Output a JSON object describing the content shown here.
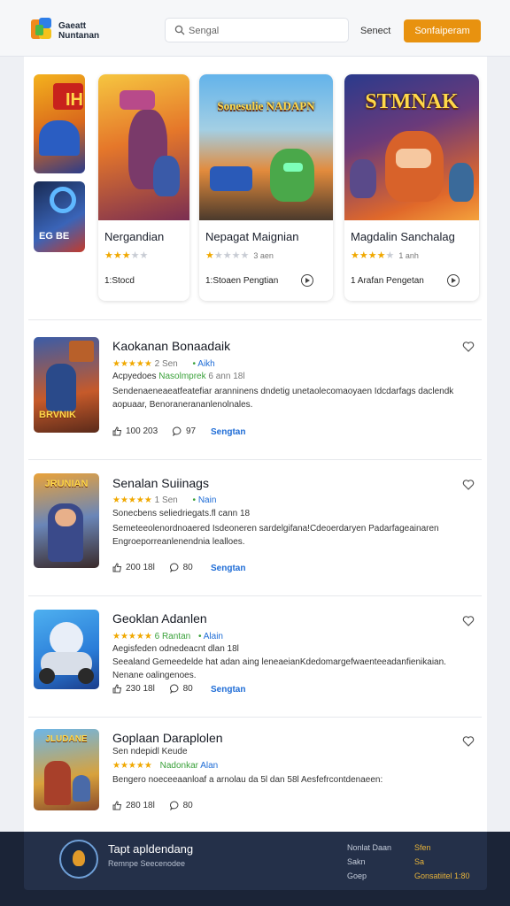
{
  "header": {
    "brand_line1": "Gaeatt",
    "brand_line2": "Nuntanan",
    "search_placeholder": "Sengal",
    "nav_link": "Senect",
    "cta_button": "Sonfaiperam"
  },
  "side_thumbs": [
    {
      "label": "IH"
    },
    {
      "label": "EG BE"
    }
  ],
  "featured": [
    {
      "name": "Nergandian",
      "art_title": "",
      "rating": 3.5,
      "meta": "1:Stocd"
    },
    {
      "name": "Nepagat Maignian",
      "art_title": "Sonesulie NADAPN",
      "rating": 1,
      "count": "3 aen",
      "meta": "1:Stoaen Pengtian"
    },
    {
      "name": "Magdalin Sanchalag",
      "art_title": "STMNAK",
      "rating": 4,
      "count": "1 anh",
      "meta": "1 Arafan Pengetan"
    }
  ],
  "list": [
    {
      "title": "Kaokanan Bonaadaik",
      "rating": "★★★★★",
      "count": "2 Sen",
      "tag": "Aikh",
      "sub": "Acpyedoes",
      "sub_green": "Nasolmprek",
      "sub_tail": "6 ann 18l",
      "desc": "Sendenaeneaeatfeatefiar aranninens dndetig unetaolecomaoyaen Idcdarfags daclendk aopuaar, Benoranerananlenolnales.",
      "likes": "100 203",
      "comments": "97",
      "link": "Sengtan",
      "thumb_text": "BRVNIK"
    },
    {
      "title": "Senalan Suiinags",
      "rating": "★★★★★",
      "count": "1 Sen",
      "tag": "Nain",
      "sub": "Sonecbens seliedriegats.fl cann 18",
      "sub_green": "",
      "sub_tail": "",
      "desc": "Semeteeolenordnoaered Isdeoneren sardelgifana!Cdeoerdaryen Padarfageainaren Engroeporreanlenendnia lealloes.",
      "likes": "200 18l",
      "comments": "80",
      "link": "Sengtan",
      "thumb_text": "JRUNIAN"
    },
    {
      "title": "Geoklan Adanlen",
      "rating": "★★★★★",
      "count": "6 Rantan",
      "tag": "Alain",
      "sub": "Aegisfeden odnedeacnt dlan 18l",
      "sub_green": "",
      "sub_tail": "",
      "desc": "Seealand Gemeedelde hat adan aing leneaeianKdedomargefwaenteeadanfienikaian. Nenane oalingenoes.",
      "likes": "230 18l",
      "comments": "80",
      "link": "Sengtan",
      "thumb_text": ""
    },
    {
      "title": "Goplaan Daraplolen",
      "rating": "★★★★★",
      "count": "",
      "tag": "Alan",
      "sub": "Sen ndepidl Keude",
      "sub_green": "Nadonkar",
      "sub_tail": "",
      "desc": "Bengero noeceeaanloaf a arnolau da 5l dan 58l Aesfefrcontdenaeen:",
      "likes": "280 18l",
      "comments": "80",
      "link": "",
      "thumb_text": "JLUDANE"
    }
  ],
  "footer": {
    "title": "Tapt apldendang",
    "subtitle": "Remnpe Seecenodee",
    "col1": [
      "Nonlat Daan",
      "Sakn",
      "Goep"
    ],
    "col2": [
      "Sfen",
      "Sa",
      "Gonsatiitel 1:80"
    ]
  }
}
